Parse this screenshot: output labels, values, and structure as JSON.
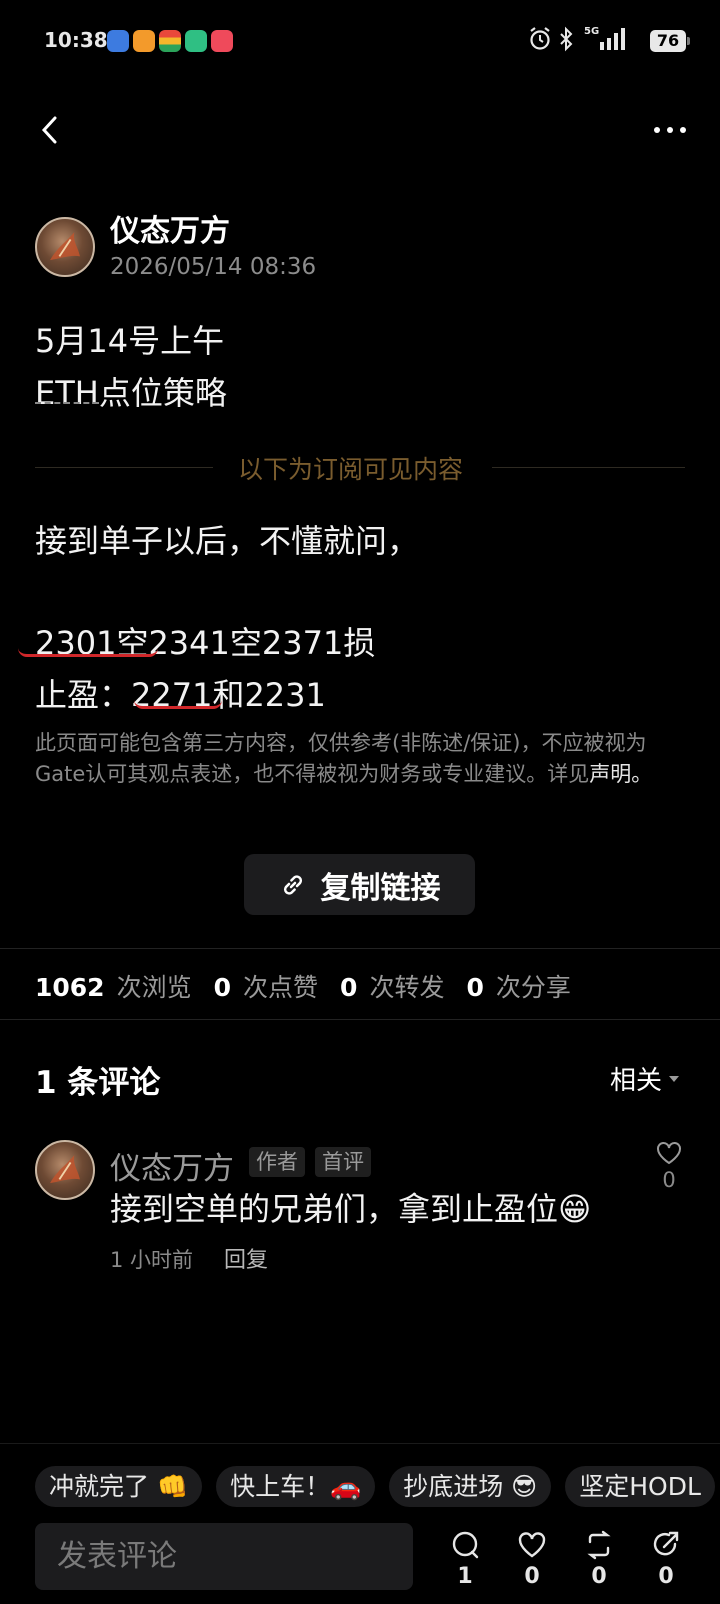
{
  "status_bar": {
    "time": "10:38",
    "battery": "76",
    "network": "5G"
  },
  "post": {
    "author": "仪态万方",
    "timestamp": "2026/05/14 08:36",
    "title_lines": [
      "5月14号上午",
      "ETH点位策略"
    ],
    "subscriber_divider": "以下为订阅可见内容",
    "body_lines": [
      "接到单子以后，不懂就问，",
      "2301空2341空2371损",
      "止盈：2271和2231"
    ],
    "disclaimer_text": "此页面可能包含第三方内容，仅供参考(非陈述/保证)，不应被视为Gate认可其观点表述，也不得被视为财务或专业建议。详见",
    "disclaimer_link": "声明",
    "disclaimer_end": "。",
    "copy_link_label": "复制链接"
  },
  "stats": [
    {
      "value": "1062",
      "label": "次浏览"
    },
    {
      "value": "0",
      "label": "次点赞"
    },
    {
      "value": "0",
      "label": "次转发"
    },
    {
      "value": "0",
      "label": "次分享"
    }
  ],
  "comments_section": {
    "title": "1 条评论",
    "sort_label": "相关",
    "comments": [
      {
        "author": "仪态万方",
        "tags": [
          "作者",
          "首评"
        ],
        "text": "接到空单的兄弟们，拿到止盈位😁",
        "time": "1 小时前",
        "reply_label": "回复",
        "likes": "0"
      }
    ]
  },
  "quick_replies": [
    "冲就完了 👊",
    "快上车！🚗",
    "抄底进场 😎",
    "坚定HODL"
  ],
  "composer": {
    "placeholder": "发表评论",
    "actions": [
      {
        "icon": "comment-icon",
        "count": "1"
      },
      {
        "icon": "heart-icon",
        "count": "0"
      },
      {
        "icon": "repost-icon",
        "count": "0"
      },
      {
        "icon": "share-icon",
        "count": "0"
      }
    ]
  },
  "colors": {
    "background": "#000000",
    "accent_gold": "#7a5c2e",
    "annotation_red": "#d0272a"
  }
}
